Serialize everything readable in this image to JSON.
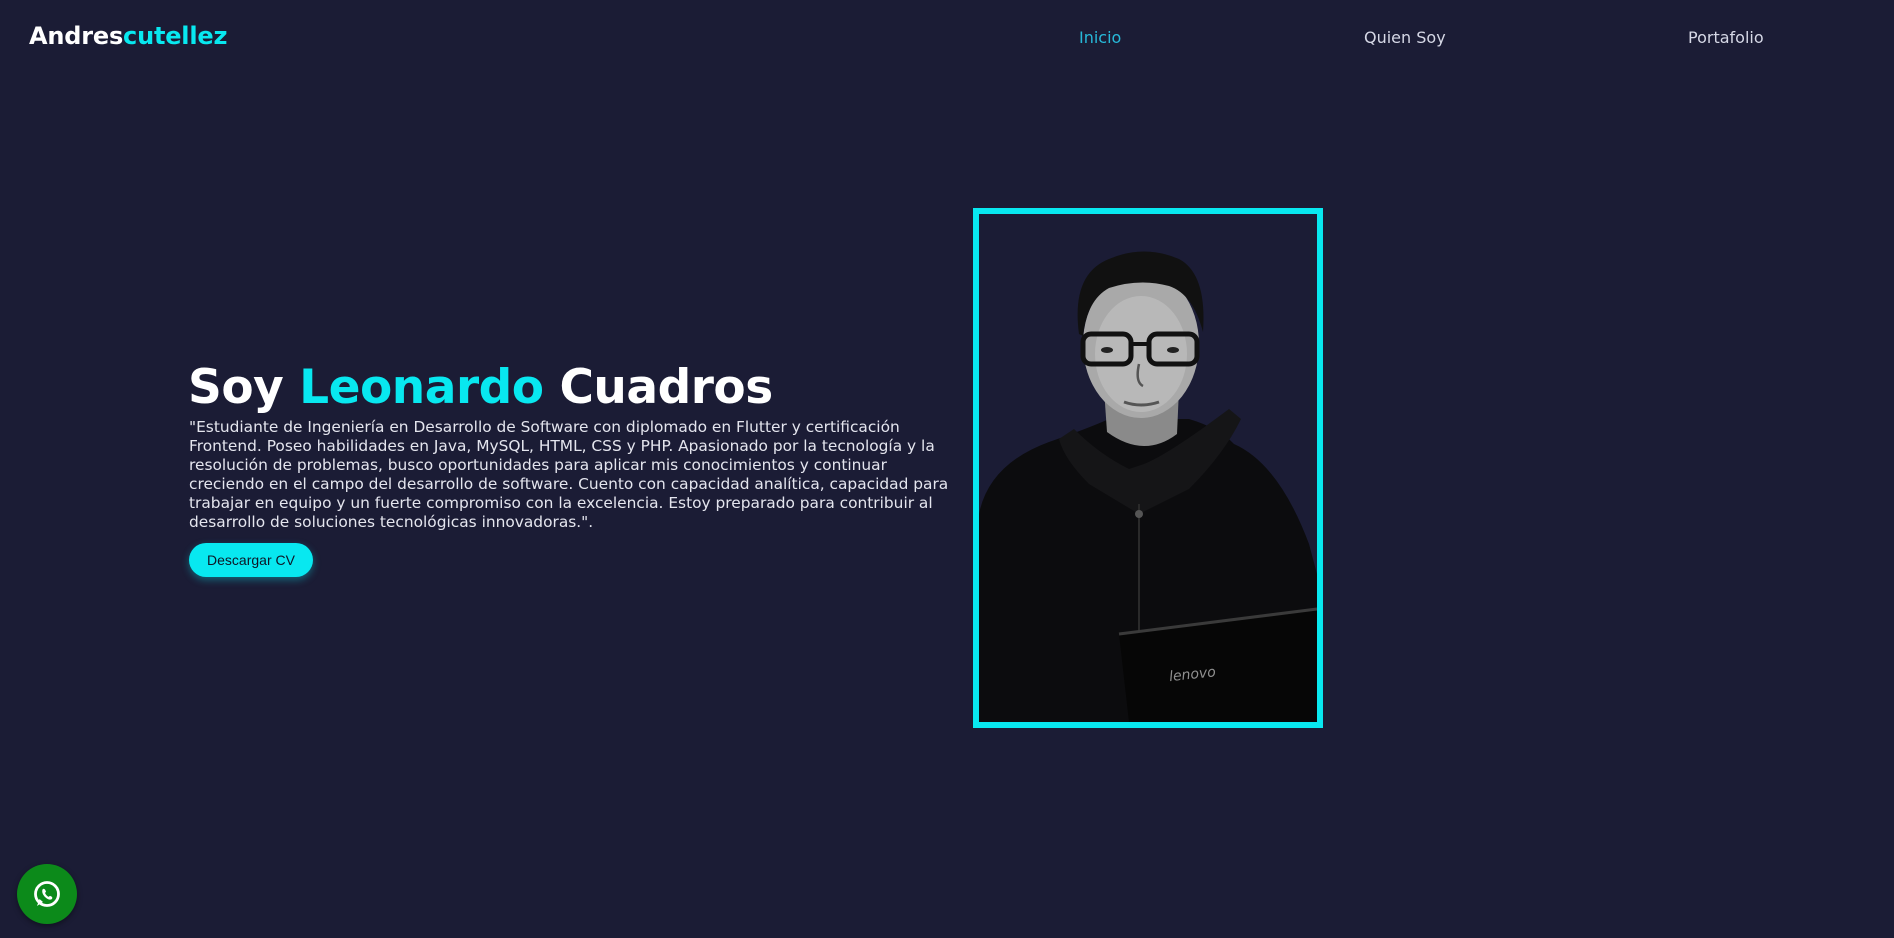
{
  "header": {
    "logo": {
      "part1": "Andres",
      "part2": "cutellez"
    },
    "nav": [
      {
        "label": "Inicio",
        "active": true
      },
      {
        "label": "Quien Soy",
        "active": false
      },
      {
        "label": "Portafolio",
        "active": false
      }
    ]
  },
  "hero": {
    "title": {
      "prefix": "Soy",
      "highlight": "Leonardo",
      "suffix": "Cuadros"
    },
    "description": "\"Estudiante de Ingeniería en Desarrollo de Software con diplomado en Flutter y certificación Frontend. Poseo habilidades en Java, MySQL, HTML, CSS y PHP. Apasionado por la tecnología y la resolución de problemas, busco oportunidades para aplicar mis conocimientos y continuar creciendo en el campo del desarrollo de software. Cuento con capacidad analítica, capacidad para trabajar en equipo y un fuerte compromiso con la excelencia. Estoy preparado para contribuir al desarrollo de soluciones tecnológicas innovadoras.\".",
    "cv_button": "Descargar CV",
    "photo_laptop_text": "lenovo"
  },
  "floating": {
    "whatsapp_icon": "whatsapp-icon"
  },
  "colors": {
    "background": "#1b1c35",
    "accent": "#08e8f0",
    "nav_active": "#27b9d9",
    "whatsapp": "#0c8a1a"
  }
}
